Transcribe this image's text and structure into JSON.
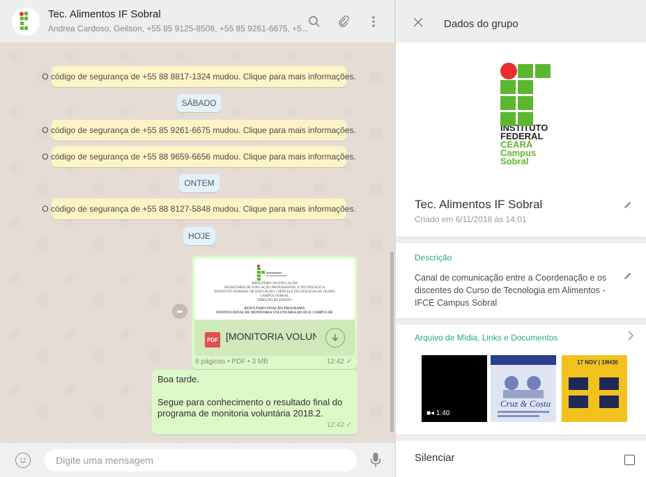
{
  "chat": {
    "title": "Tec. Alimentos IF Sobral",
    "subtitle": "Andrea Cardoso, Geilson, +55 85 9125-8508, +55 85 9261-6675, +5...",
    "icons": [
      "search-icon",
      "attach-icon",
      "menu-icon"
    ],
    "messages": {
      "sys1": "O código de segurança de +55 88 8817-1324 mudou. Clique para mais informações.",
      "day1": "SÁBADO",
      "sys2": "O código de segurança de +55 85 9261-6675 mudou. Clique para mais informações.",
      "sys3": "O código de segurança de +55 88 9659-6656 mudou. Clique para mais informações.",
      "day2": "ONTEM",
      "sys4": "O código de segurança de +55 88 8127-5848 mudou. Clique para mais informações.",
      "day3": "HOJE"
    },
    "document": {
      "name": "[MONITORIA VOLUNTÁRIA].pdf",
      "display_name": "[MONITORIA VOLUN...",
      "type_badge": "PDF",
      "meta": "8 páginas • PDF • 3 MB",
      "time": "12:42 ✓",
      "preview_lines": [
        "MINISTÉRIO DA EDUCAÇÃO",
        "SECRETARIA DE EDUCAÇÃO PROFISSIONAL E TECNOLÓGICA",
        "INSTITUTO FEDERAL DE EDUCAÇÃO, CIÊNCIA E TECNOLOGIA DO CEARÁ",
        "CAMPUS SOBRAL",
        "DIREÇÃO DE ENSINO",
        "RESULTADO FINAL DO PROGRAMA",
        "INSTITUCIONAL DE MONITORIA VOLUNTÁRIA DO IFCE CAMPUS DE"
      ]
    },
    "text_message": {
      "line1": "Boa tarde.",
      "line2": "Segue para conhecimento o resultado final do programa de monitoria voluntária 2018.2.",
      "time": "12:42 ✓"
    },
    "composer": {
      "placeholder": "Digite uma mensagem"
    }
  },
  "info": {
    "header_title": "Dados do grupo",
    "logo": {
      "line1": "INSTITUTO",
      "line2": "FEDERAL",
      "line3": "CEARÁ",
      "line4": "Campus",
      "line5": "Sobral"
    },
    "group_name": "Tec. Alimentos  IF Sobral",
    "created": "Criado em 6/11/2018 às 14:01",
    "description_label": "Descrição",
    "description": "Canal de comunicação entre a Coordenação e os discentes do Curso de Tecnologia em Alimentos - IFCE Campus Sobral",
    "media_label": "Arquivo de Mídia, Links e Documentos",
    "media": {
      "video_duration": "1:40",
      "thumb2_caption": "Cruz & Costa",
      "thumb3_caption": "17 NOV | 19H30"
    },
    "mute_label": "Silenciar"
  },
  "colors": {
    "accent": "#22a87d",
    "outgoing_bubble": "#dcf8c6",
    "system_bubble": "#fdf4c5",
    "day_pill": "#e1f2fb",
    "if_green": "#5cb630",
    "if_red": "#e53030"
  }
}
